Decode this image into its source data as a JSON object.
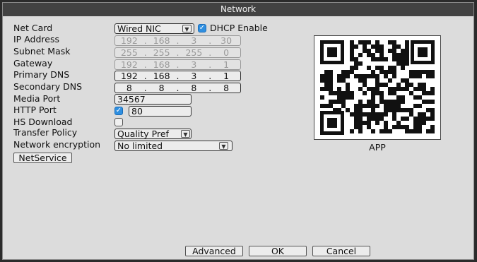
{
  "window": {
    "title": "Network"
  },
  "labels": {
    "net_card": "Net Card",
    "ip_address": "IP Address",
    "subnet_mask": "Subnet Mask",
    "gateway": "Gateway",
    "primary_dns": "Primary DNS",
    "secondary_dns": "Secondary DNS",
    "media_port": "Media Port",
    "http_port": "HTTP Port",
    "hs_download": "HS Download",
    "transfer_policy": "Transfer Policy",
    "network_encryption": "Network encryption"
  },
  "fields": {
    "net_card": "Wired NIC",
    "dhcp_label": "DHCP Enable",
    "dhcp_checked": true,
    "ip_address": [
      "192",
      "168",
      "3",
      "30"
    ],
    "subnet_mask": [
      "255",
      "255",
      "255",
      "0"
    ],
    "gateway": [
      "192",
      "168",
      "3",
      "1"
    ],
    "primary_dns": [
      "192",
      "168",
      "3",
      "1"
    ],
    "secondary_dns": [
      "8",
      "8",
      "8",
      "8"
    ],
    "media_port": "34567",
    "http_checked": true,
    "http_port": "80",
    "hs_download_checked": false,
    "transfer_policy": "Quality Pref",
    "network_encryption": "No limited"
  },
  "buttons": {
    "netservice": "NetService",
    "advanced": "Advanced",
    "ok": "OK",
    "cancel": "Cancel"
  },
  "qr": {
    "caption": "APP"
  },
  "icons": {
    "dropdown": "chevron-down-icon",
    "check": "check-icon"
  }
}
